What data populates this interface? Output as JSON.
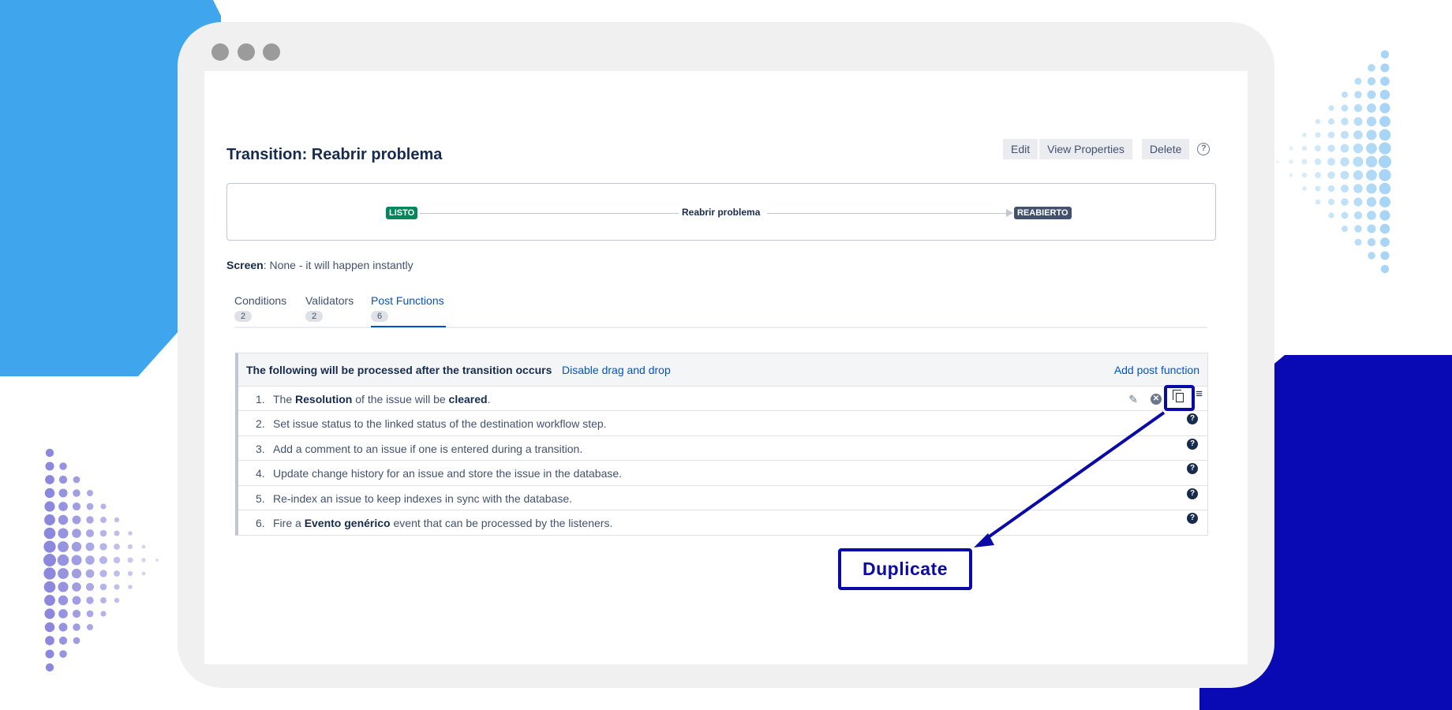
{
  "page": {
    "title": "Transition: Reabrir problema"
  },
  "actions": {
    "edit": "Edit",
    "view_properties": "View Properties",
    "delete": "Delete",
    "help": "?"
  },
  "diagram": {
    "from_status": "LISTO",
    "transition": "Reabrir problema",
    "to_status": "REABIERTO"
  },
  "screen": {
    "label": "Screen",
    "value": ": None - it will happen instantly"
  },
  "tabs": [
    {
      "label": "Conditions",
      "count": "2"
    },
    {
      "label": "Validators",
      "count": "2"
    },
    {
      "label": "Post Functions",
      "count": "6"
    }
  ],
  "post_functions": {
    "header": "The following will be processed after the transition occurs",
    "disable_link": "Disable drag and drop",
    "add_link": "Add post function",
    "rows": [
      {
        "num": "1.",
        "pre": "The ",
        "b1": "Resolution",
        "mid": " of the issue will be ",
        "b2": "cleared",
        "post": "."
      },
      {
        "num": "2.",
        "text": "Set issue status to the linked status of the destination workflow step."
      },
      {
        "num": "3.",
        "text": "Add a comment to an issue if one is entered during a transition."
      },
      {
        "num": "4.",
        "text": "Update change history for an issue and store the issue in the database."
      },
      {
        "num": "5.",
        "text": "Re-index an issue to keep indexes in sync with the database."
      },
      {
        "num": "6.",
        "pre": "Fire a ",
        "b1": "Evento genérico",
        "post": " event that can be processed by the listeners."
      }
    ]
  },
  "callout": {
    "label": "Duplicate"
  },
  "colors": {
    "accent": "#0052cc",
    "annotation": "#0a0aa8",
    "status_done": "#00875a",
    "status_reopened": "#42526e"
  }
}
